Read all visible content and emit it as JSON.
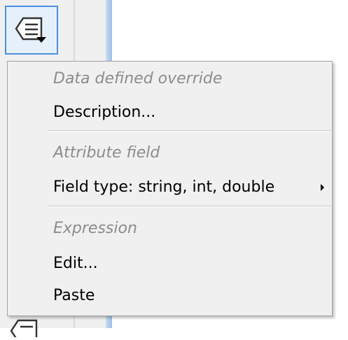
{
  "dd_button": {
    "icon": "data-defined-override-icon"
  },
  "menu": {
    "sections": [
      {
        "header": "Data defined override",
        "items": [
          {
            "label": "Description...",
            "has_submenu": false
          }
        ]
      },
      {
        "header": "Attribute field",
        "items": [
          {
            "label": "Field type: string, int, double",
            "has_submenu": true
          }
        ]
      },
      {
        "header": "Expression",
        "items": [
          {
            "label": "Edit...",
            "has_submenu": false
          },
          {
            "label": "Paste",
            "has_submenu": false
          }
        ]
      }
    ]
  },
  "colors": {
    "menu_background": "#f0f0f0",
    "header_text": "#8c8c8c",
    "item_text": "#000000",
    "button_border": "#4a90e2"
  }
}
